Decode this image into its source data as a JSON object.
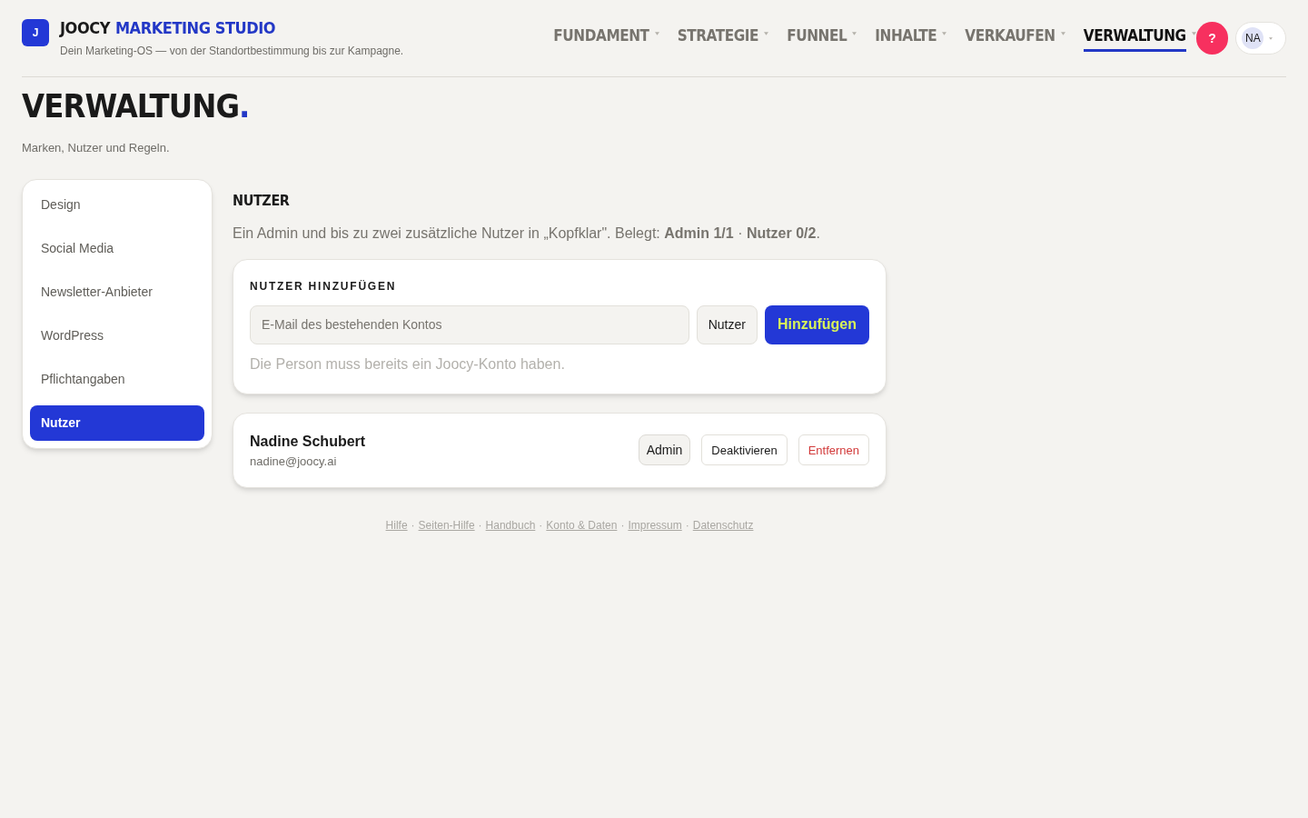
{
  "brand": {
    "logo_letter": "J",
    "name": "JOOCY",
    "name_accent": "MARKETING STUDIO",
    "tagline": "Dein Marketing-OS — von der Standortbestimmung bis zur Kampagne."
  },
  "nav": [
    {
      "label": "FUNDAMENT",
      "selected": false
    },
    {
      "label": "STRATEGIE",
      "selected": false
    },
    {
      "label": "FUNNEL",
      "selected": false
    },
    {
      "label": "INHALTE",
      "selected": false
    },
    {
      "label": "VERKAUFEN",
      "selected": false
    },
    {
      "label": "VERWALTUNG",
      "selected": true
    }
  ],
  "help_button": "?",
  "account": {
    "initials": "NA"
  },
  "page": {
    "title": "VERWALTUNG",
    "title_accent": ".",
    "subtitle": "Marken, Nutzer und Regeln."
  },
  "sidebar": [
    {
      "label": "Design",
      "selected": false
    },
    {
      "label": "Social Media",
      "selected": false
    },
    {
      "label": "Newsletter-Anbieter",
      "selected": false
    },
    {
      "label": "WordPress",
      "selected": false
    },
    {
      "label": "Pflichtangaben",
      "selected": false
    },
    {
      "label": "Nutzer",
      "selected": true
    }
  ],
  "section": {
    "title": "NUTZER",
    "description": "Ein Admin und bis zu zwei zusätzliche Nutzer in „Kopfklar\". Belegt: **Admin 1/1** · **Nutzer 0/2**."
  },
  "add_user": {
    "heading": "NUTZER HINZUFÜGEN",
    "placeholder": "E-Mail des bestehenden Kontos",
    "role": "Nutzer",
    "submit": "Hinzufügen",
    "hint": "Die Person muss bereits ein Joocy-Konto haben."
  },
  "users": [
    {
      "name": "Nadine Schubert",
      "email": "nadine@joocy.ai",
      "role": "Admin",
      "actions": [
        {
          "label": "Deaktivieren",
          "kind": "neutral"
        },
        {
          "label": "Entfernen",
          "kind": "danger"
        }
      ]
    }
  ],
  "footer": {
    "separator": "·",
    "links": [
      "Hilfe",
      "Seiten-Hilfe",
      "Handbuch",
      "Konto & Daten",
      "Impressum",
      "Datenschutz"
    ]
  }
}
